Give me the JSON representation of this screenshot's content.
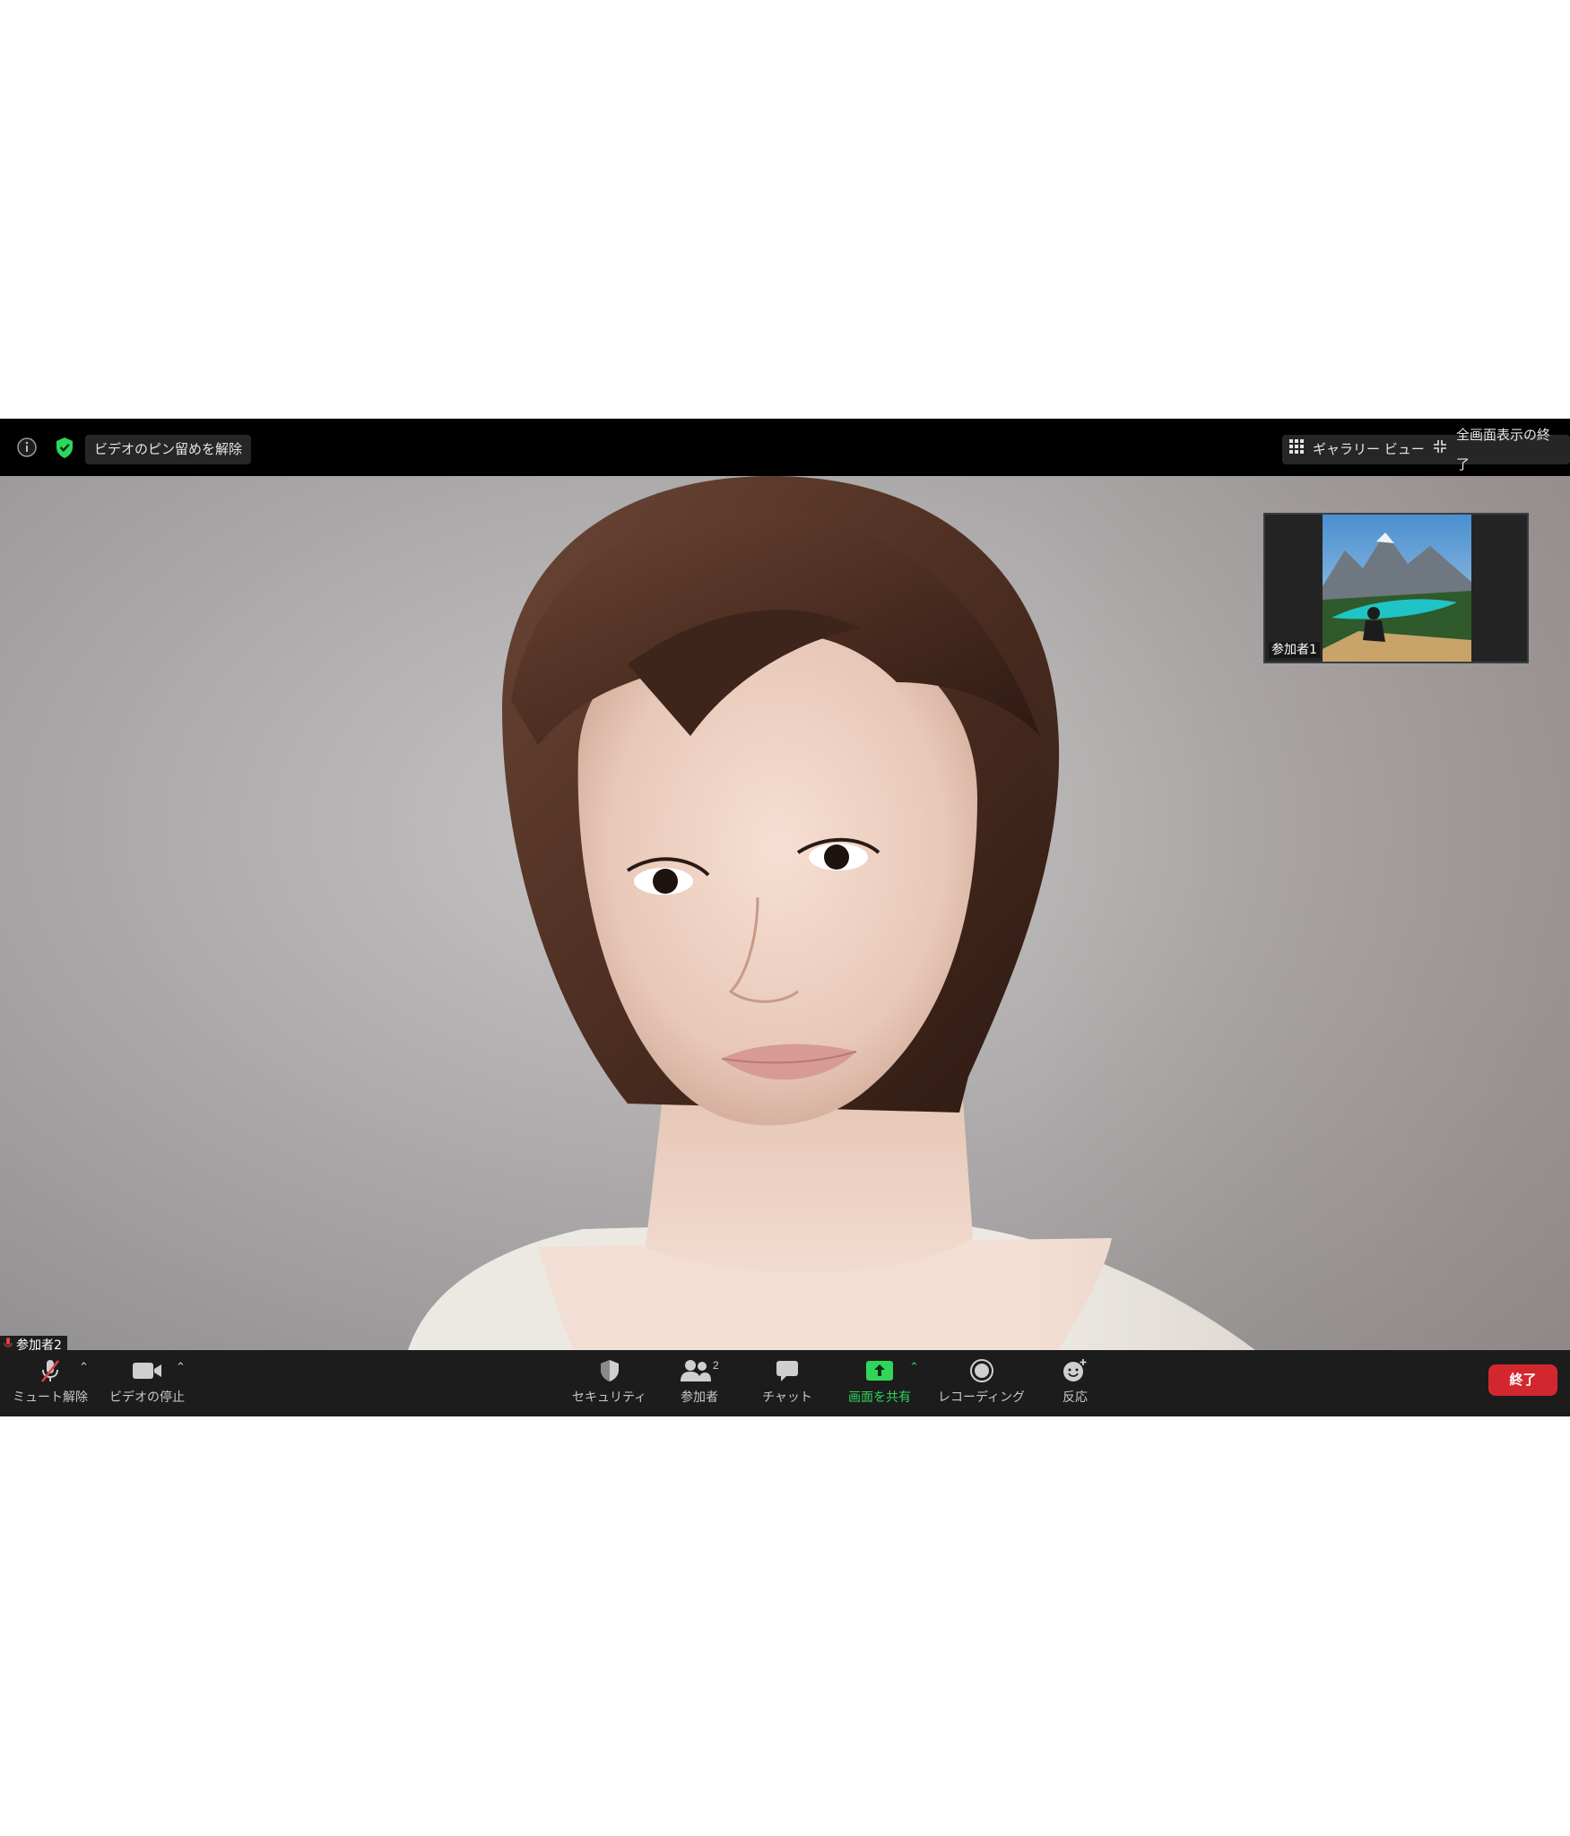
{
  "topbar": {
    "unpin_label": "ビデオのピン留めを解除",
    "gallery_label": "ギャラリー ビュー",
    "exit_fullscreen_label": "全画面表示の終了"
  },
  "thumbnail": {
    "participant_label": "参加者1"
  },
  "speaker": {
    "name": "参加者2"
  },
  "toolbar": {
    "mute_label": "ミュート解除",
    "video_label": "ビデオの停止",
    "security_label": "セキュリティ",
    "participants_label": "参加者",
    "participants_count": "2",
    "chat_label": "チャット",
    "share_label": "画面を共有",
    "record_label": "レコーディング",
    "reactions_label": "反応",
    "end_label": "終了"
  },
  "colors": {
    "accent_green": "#2fd65a",
    "end_red": "#d3272f",
    "toolbar_bg": "#1c1c1c"
  },
  "icons": [
    "info-icon",
    "shield-check-icon",
    "grid-icon",
    "exit-fullscreen-icon",
    "mic-muted-icon",
    "camera-icon",
    "security-shield-icon",
    "participants-icon",
    "chat-icon",
    "share-screen-icon",
    "record-icon",
    "reaction-icon"
  ]
}
